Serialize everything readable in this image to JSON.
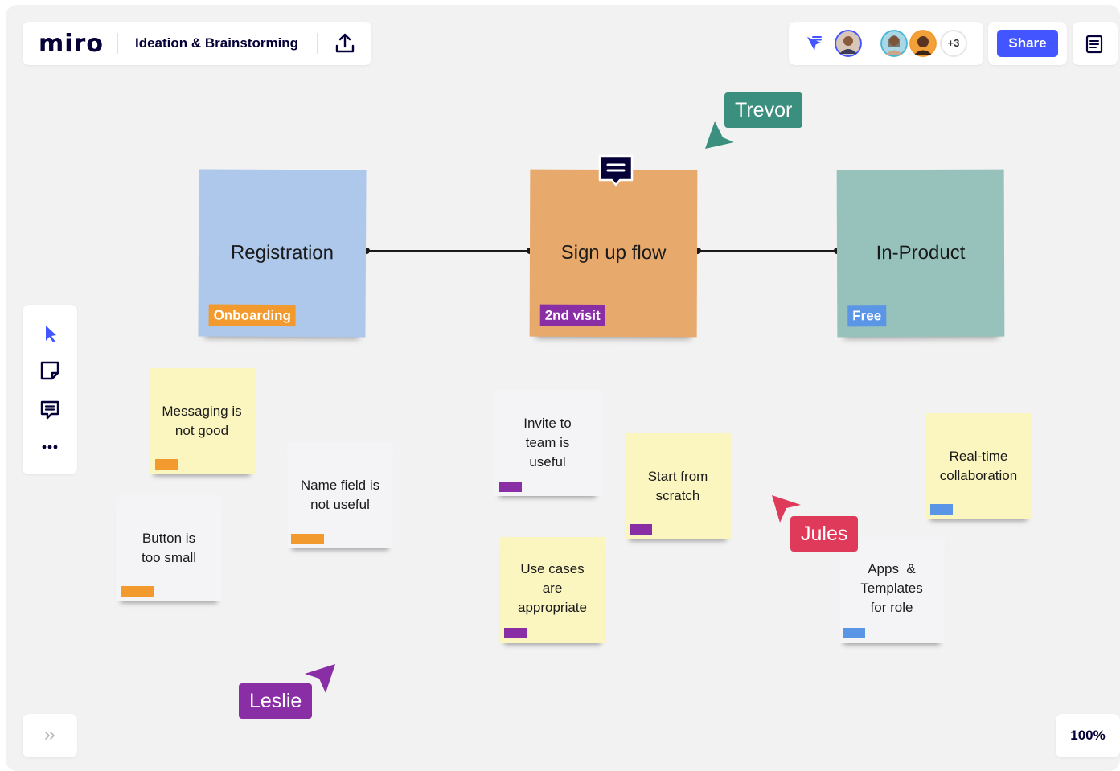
{
  "app": {
    "logo": "miro",
    "board_title": "Ideation & Brainstorming"
  },
  "collaborators": {
    "more_count": "+3",
    "share_label": "Share"
  },
  "zoom": {
    "level": "100%"
  },
  "stages": [
    {
      "title": "Registration",
      "tag": "Onboarding",
      "color": "#aec8ec",
      "tag_color": "#f29a2e"
    },
    {
      "title": "Sign up flow",
      "tag": "2nd visit",
      "color": "#e8a96c",
      "tag_color": "#8a2ea6"
    },
    {
      "title": "In-Product",
      "tag": "Free",
      "color": "#97c2bb",
      "tag_color": "#5a95e6"
    }
  ],
  "stickies": [
    {
      "text": [
        "Messaging is",
        "not good"
      ],
      "color": "#fbf6bf",
      "chip_color": "#f29a2e"
    },
    {
      "text": [
        "Button is",
        "too small"
      ],
      "color": "#f4f4f6",
      "chip_color": "#f29a2e"
    },
    {
      "text": [
        "Name field is",
        "not useful"
      ],
      "color": "#f4f4f6",
      "chip_color": "#f29a2e"
    },
    {
      "text": [
        "Invite to",
        "team is",
        "useful"
      ],
      "color": "#f4f4f6",
      "chip_color": "#8a2ea6"
    },
    {
      "text": [
        "Start from",
        "scratch"
      ],
      "color": "#fbf6bf",
      "chip_color": "#8a2ea6"
    },
    {
      "text": [
        "Use cases",
        "are",
        "appropriate"
      ],
      "color": "#fbf6bf",
      "chip_color": "#8a2ea6"
    },
    {
      "text": [
        "Real-time",
        "collaboration"
      ],
      "color": "#fbf6bf",
      "chip_color": "#5a95e6"
    },
    {
      "text": [
        "Apps  &",
        "Templates",
        "for role"
      ],
      "color": "#f4f4f6",
      "chip_color": "#5a95e6"
    }
  ],
  "cursors": [
    {
      "name": "Trevor",
      "color": "#3a8f7e"
    },
    {
      "name": "Jules",
      "color": "#e03a5b"
    },
    {
      "name": "Leslie",
      "color": "#8a2ea6"
    }
  ],
  "icons": {
    "upload": "upload-icon",
    "filter": "follow-icon",
    "notes": "notes-icon",
    "select": "cursor-icon",
    "sticky": "sticky-note-icon",
    "comment": "comment-icon",
    "more": "more-icon",
    "expand": "double-chevron-right-icon"
  }
}
